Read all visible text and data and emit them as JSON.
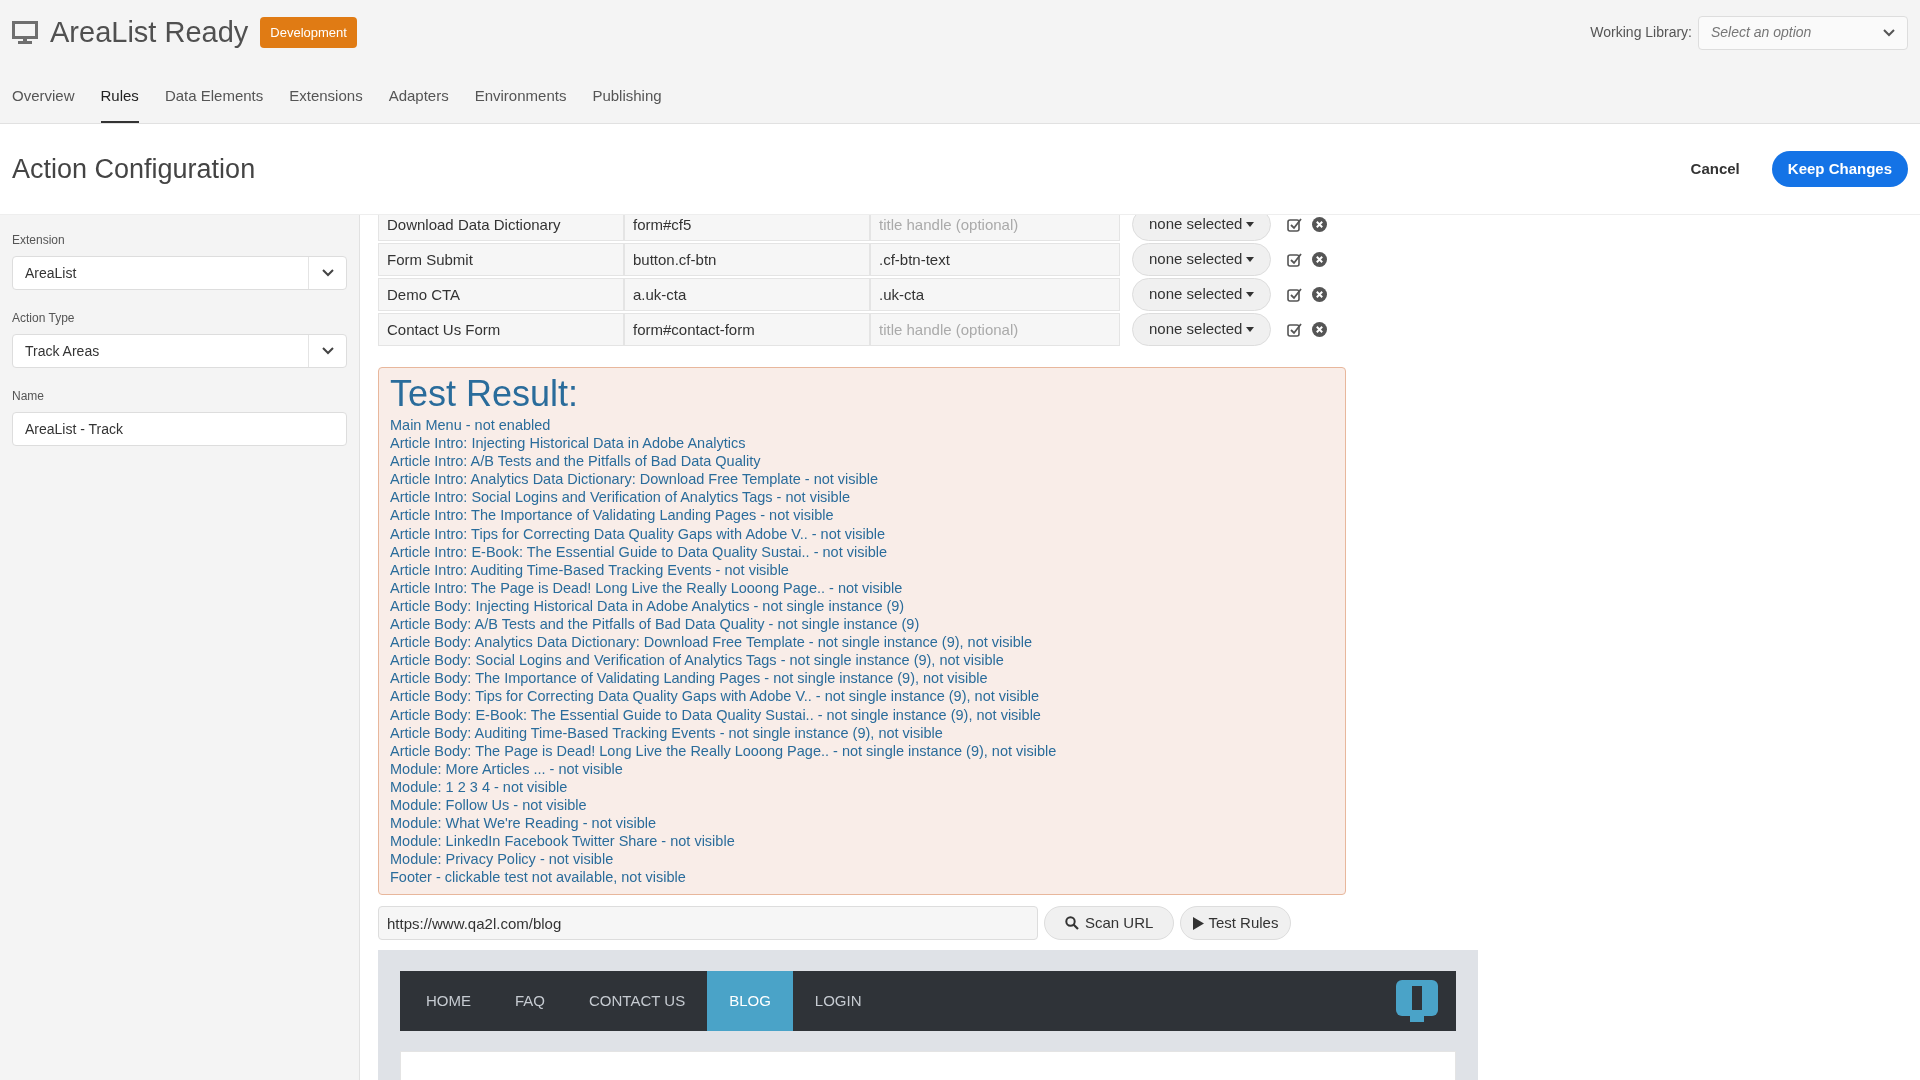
{
  "header": {
    "title": "AreaList Ready",
    "badge": "Development",
    "library_label": "Working Library:",
    "library_select": {
      "placeholder": "Select an option"
    }
  },
  "nav_tabs": [
    {
      "label": "Overview",
      "selected": false
    },
    {
      "label": "Rules",
      "selected": true
    },
    {
      "label": "Data Elements",
      "selected": false
    },
    {
      "label": "Extensions",
      "selected": false
    },
    {
      "label": "Adapters",
      "selected": false
    },
    {
      "label": "Environments",
      "selected": false
    },
    {
      "label": "Publishing",
      "selected": false
    }
  ],
  "page_title": "Action Configuration",
  "actions": {
    "cancel": "Cancel",
    "keep": "Keep Changes"
  },
  "sidebar": {
    "fields": [
      {
        "kind": "select",
        "label": "Extension",
        "value": "AreaList"
      },
      {
        "kind": "select",
        "label": "Action Type",
        "value": "Track Areas"
      },
      {
        "kind": "text",
        "label": "Name",
        "value": "AreaList - Track"
      }
    ]
  },
  "rules": [
    {
      "name": "Download Data Dictionary",
      "selector": "form#cf5",
      "title_handle": {
        "placeholder": "title handle (optional)"
      },
      "dropdown": "none selected"
    },
    {
      "name": "Form Submit",
      "selector": "button.cf-btn",
      "title_handle": {
        "value": ".cf-btn-text"
      },
      "dropdown": "none selected"
    },
    {
      "name": "Demo CTA",
      "selector": "a.uk-cta",
      "title_handle": {
        "value": ".uk-cta"
      },
      "dropdown": "none selected"
    },
    {
      "name": "Contact Us Form",
      "selector": "form#contact-form",
      "title_handle": {
        "placeholder": "title handle (optional)"
      },
      "dropdown": "none selected"
    }
  ],
  "test_result": {
    "title": "Test Result:",
    "lines": [
      "Main Menu - not enabled",
      "Article Intro: Injecting Historical Data in Adobe Analytics",
      "Article Intro: A/B Tests and the Pitfalls of Bad Data Quality",
      "Article Intro: Analytics Data Dictionary: Download Free Template - not visible",
      "Article Intro: Social Logins and Verification of Analytics Tags - not visible",
      "Article Intro: The Importance of Validating Landing Pages - not visible",
      "Article Intro: Tips for Correcting Data Quality Gaps with Adobe V.. - not visible",
      "Article Intro: E-Book: The Essential Guide to Data Quality Sustai.. - not visible",
      "Article Intro: Auditing Time-Based Tracking Events - not visible",
      "Article Intro: The Page is Dead! Long Live the Really Looong Page.. - not visible",
      "Article Body: Injecting Historical Data in Adobe Analytics - not single instance (9)",
      "Article Body: A/B Tests and the Pitfalls of Bad Data Quality - not single instance (9)",
      "Article Body: Analytics Data Dictionary: Download Free Template - not single instance (9), not visible",
      "Article Body: Social Logins and Verification of Analytics Tags - not single instance (9), not visible",
      "Article Body: The Importance of Validating Landing Pages - not single instance (9), not visible",
      "Article Body: Tips for Correcting Data Quality Gaps with Adobe V.. - not single instance (9), not visible",
      "Article Body: E-Book: The Essential Guide to Data Quality Sustai.. - not single instance (9), not visible",
      "Article Body: Auditing Time-Based Tracking Events - not single instance (9), not visible",
      "Article Body: The Page is Dead! Long Live the Really Looong Page.. - not single instance (9), not visible",
      "Module: More Articles ... - not visible",
      "Module: 1 2 3 4 - not visible",
      "Module: Follow Us - not visible",
      "Module: What We're Reading - not visible",
      "Module: LinkedIn Facebook Twitter Share - not visible",
      "Module: Privacy Policy - not visible",
      "Footer - clickable test not available, not visible"
    ]
  },
  "scan": {
    "url": "https://www.qa2l.com/blog",
    "scan_button": "Scan URL",
    "test_button": "Test Rules"
  },
  "preview": {
    "nav": [
      {
        "label": "HOME",
        "selected": false
      },
      {
        "label": "FAQ",
        "selected": false
      },
      {
        "label": "CONTACT US",
        "selected": false
      },
      {
        "label": "BLOG",
        "selected": true
      },
      {
        "label": "LOGIN",
        "selected": false
      }
    ]
  }
}
